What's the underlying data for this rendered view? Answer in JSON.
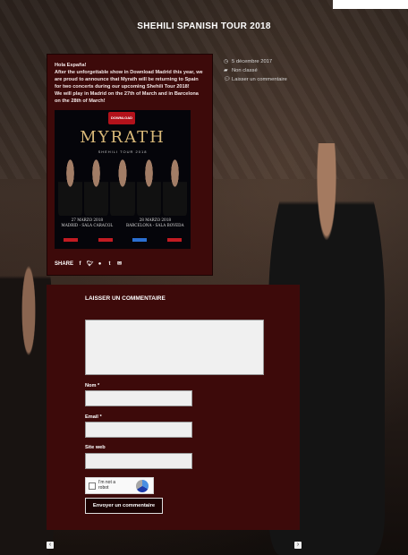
{
  "page": {
    "title": "SHEHILI SPANISH TOUR 2018"
  },
  "post": {
    "paragraphs": [
      "Hola España!",
      "After the unforgettable show in Download Madrid this year, we are proud to announce that Myrath will be returning to Spain for two concerts during our upcoming Shehili Tour 2018!",
      "We will play in Madrid on the 27th of March and in Barcelona on the 28th of March!"
    ],
    "poster": {
      "logo": "DOWNLOAD",
      "band": "MYRATH",
      "subtitle": "SHEHILI TOUR 2018",
      "date_left_1": "27 MARZO 2018",
      "date_left_2": "MADRID - SALA CARACOL",
      "date_right_1": "28 MARZO 2018",
      "date_right_2": "BARCELONA - SALA BOVEDA"
    },
    "share_label": "SHARE",
    "share_icons": [
      "facebook-icon",
      "twitter-icon",
      "pinterest-icon",
      "tumblr-icon",
      "email-icon"
    ]
  },
  "meta": {
    "date": "5 décembre 2017",
    "category": "Non classé",
    "comment_link": "Laisser un commentaire"
  },
  "comment_form": {
    "heading": "LAISSER UN COMMENTAIRE",
    "comment_value": "",
    "name_label": "Nom *",
    "name_value": "",
    "email_label": "Email *",
    "email_value": "",
    "website_label": "Site web",
    "website_value": "",
    "captcha_label": "I'm not a robot",
    "submit_label": "Envoyer un commentaire"
  },
  "colors": {
    "panel": "#3d0a0a",
    "page_bg": "#2a211c"
  }
}
